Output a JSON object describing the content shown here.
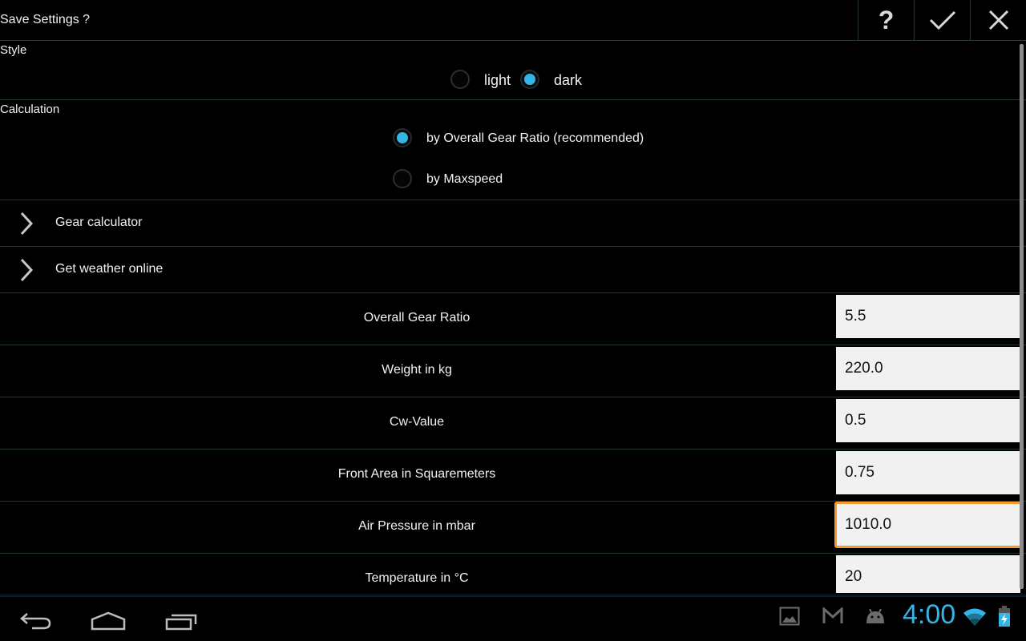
{
  "titlebar": {
    "title": "Save Settings ?",
    "help_label": "?",
    "actions": [
      "help-icon",
      "checkmark-icon",
      "close-icon"
    ]
  },
  "style": {
    "label": "Style",
    "options": [
      {
        "label": "light",
        "selected": false
      },
      {
        "label": "dark",
        "selected": true
      }
    ]
  },
  "calculation": {
    "label": "Calculation",
    "options": [
      {
        "label": "by Overall Gear Ratio (recommended)",
        "selected": true
      },
      {
        "label": "by Maxspeed",
        "selected": false
      }
    ]
  },
  "expanders": [
    {
      "label": "Gear calculator",
      "icon": "chevron-right-icon"
    },
    {
      "label": "Get weather online",
      "icon": "chevron-right-icon"
    }
  ],
  "fields": [
    {
      "label": "Overall Gear Ratio",
      "value": "5.5",
      "focused": false
    },
    {
      "label": "Weight in kg",
      "value": "220.0",
      "focused": false
    },
    {
      "label": "Cw-Value",
      "value": "0.5",
      "focused": false
    },
    {
      "label": "Front Area in Squaremeters",
      "value": "0.75",
      "focused": false
    },
    {
      "label": "Air Pressure in mbar",
      "value": "1010.0",
      "focused": true
    },
    {
      "label": "Temperature in °C",
      "value": "20",
      "focused": false
    }
  ],
  "navbar": {
    "buttons": [
      "back-icon",
      "home-icon",
      "recent-apps-icon"
    ],
    "notifications": [
      "gallery-icon",
      "gmail-icon",
      "android-icon"
    ],
    "clock": "4:00",
    "status": [
      "wifi-icon",
      "battery-charging-icon"
    ]
  },
  "colors": {
    "accent": "#33b5e5",
    "focus": "#f39a2b",
    "background": "#000000",
    "input_bg": "#f1f1f1"
  }
}
